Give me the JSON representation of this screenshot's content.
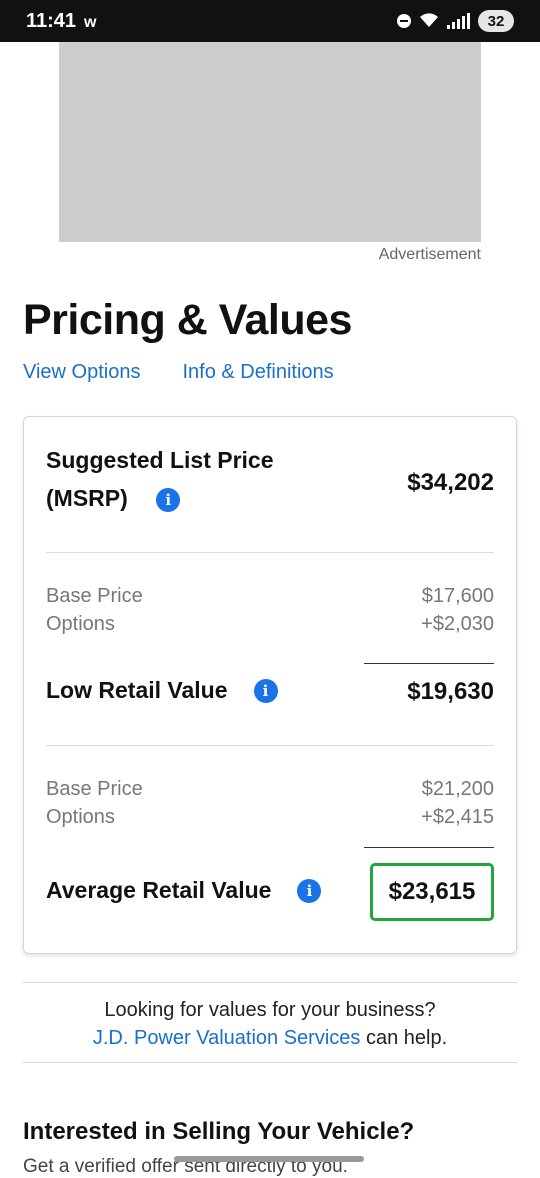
{
  "status_bar": {
    "time": "11:41",
    "carrier_icon_text": "w",
    "wifi_label": "6",
    "battery": "32"
  },
  "ad": {
    "label": "Advertisement"
  },
  "page": {
    "title": "Pricing & Values",
    "links": [
      "View Options",
      "Info & Definitions"
    ]
  },
  "pricing": {
    "msrp": {
      "label": "Suggested List Price (MSRP)",
      "value": "$34,202"
    },
    "low_retail": {
      "base_label": "Base Price",
      "base_value": "$17,600",
      "options_label": "Options",
      "options_value": "+$2,030",
      "label": "Low Retail Value",
      "value": "$19,630"
    },
    "average_retail": {
      "base_label": "Base Price",
      "base_value": "$21,200",
      "options_label": "Options",
      "options_value": "+$2,415",
      "label": "Average Retail Value",
      "value": "$23,615"
    }
  },
  "business": {
    "line1": "Looking for values for your business?",
    "link": "J.D. Power Valuation Services",
    "line2_suffix": "can help."
  },
  "sell": {
    "title": "Interested in Selling Your Vehicle?",
    "subtitle": "Get a verified offer sent directly to you."
  },
  "colors": {
    "link": "#1a6fc9",
    "info_icon": "#1a73e8",
    "highlight_border": "#22a63b",
    "ad_placeholder": "#cdcdcd"
  }
}
